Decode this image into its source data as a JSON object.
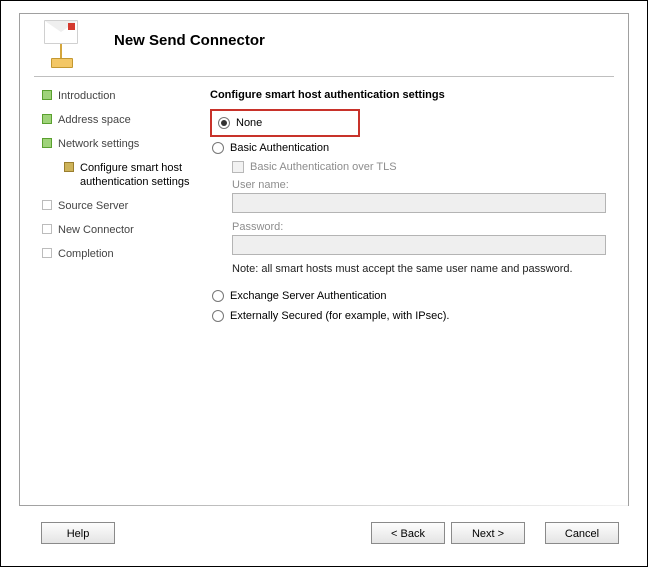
{
  "header": {
    "title": "New Send Connector"
  },
  "sidebar": {
    "items": [
      {
        "label": "Introduction"
      },
      {
        "label": "Address space"
      },
      {
        "label": "Network settings"
      },
      {
        "label": "Configure smart host authentication settings"
      },
      {
        "label": "Source Server"
      },
      {
        "label": "New Connector"
      },
      {
        "label": "Completion"
      }
    ]
  },
  "content": {
    "section_title": "Configure smart host authentication settings",
    "radio_none": "None",
    "radio_basic": "Basic Authentication",
    "check_tls": "Basic Authentication over TLS",
    "label_user": "User name:",
    "label_pass": "Password:",
    "note": "Note: all smart hosts must accept the same user name and password.",
    "radio_exchange": "Exchange Server Authentication",
    "radio_ipsec": "Externally Secured (for example, with IPsec)."
  },
  "footer": {
    "help": "Help",
    "back": "< Back",
    "next": "Next >",
    "cancel": "Cancel"
  }
}
